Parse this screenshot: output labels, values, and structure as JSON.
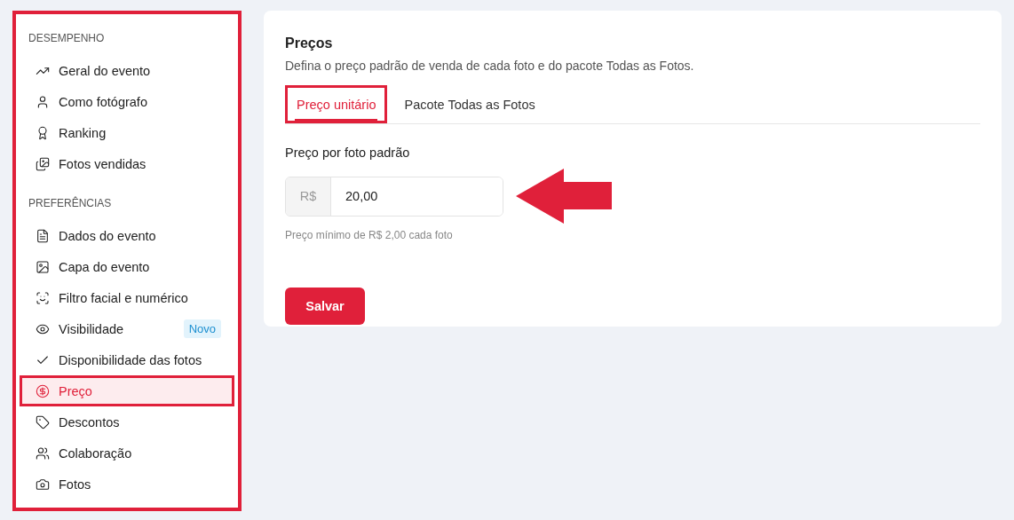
{
  "sidebar": {
    "highlighted": true,
    "sections": [
      {
        "title": "DESEMPENHO",
        "items": [
          {
            "kind": "trend",
            "label": "Geral do evento",
            "selected": false,
            "highlighted": false
          },
          {
            "kind": "user",
            "label": "Como fotógrafo",
            "selected": false,
            "highlighted": false
          },
          {
            "kind": "award",
            "label": "Ranking",
            "selected": false,
            "highlighted": false
          },
          {
            "kind": "images",
            "label": "Fotos vendidas",
            "selected": false,
            "highlighted": false
          }
        ]
      },
      {
        "title": "PREFERÊNCIAS",
        "items": [
          {
            "kind": "file",
            "label": "Dados do evento",
            "selected": false,
            "highlighted": false
          },
          {
            "kind": "image",
            "label": "Capa do evento",
            "selected": false,
            "highlighted": false
          },
          {
            "kind": "face",
            "label": "Filtro facial e numérico",
            "selected": false,
            "highlighted": false
          },
          {
            "kind": "eye",
            "label": "Visibilidade",
            "badge": "Novo",
            "selected": false,
            "highlighted": false
          },
          {
            "kind": "check",
            "label": "Disponibilidade das fotos",
            "selected": false,
            "highlighted": false
          },
          {
            "kind": "dollar",
            "label": "Preço",
            "selected": true,
            "highlighted": true
          },
          {
            "kind": "tag",
            "label": "Descontos",
            "selected": false,
            "highlighted": false
          },
          {
            "kind": "users",
            "label": "Colaboração",
            "selected": false,
            "highlighted": false
          },
          {
            "kind": "camera",
            "label": "Fotos",
            "selected": false,
            "highlighted": false
          }
        ]
      }
    ]
  },
  "card": {
    "title": "Preços",
    "description": "Defina o preço padrão de venda de cada foto e do pacote Todas as Fotos.",
    "tabs": [
      {
        "label": "Preço unitário",
        "selected": true,
        "highlighted": true
      },
      {
        "label": "Pacote Todas as Fotos",
        "selected": false,
        "highlighted": false
      }
    ],
    "price_field": {
      "label": "Preço por foto padrão",
      "prefix": "R$",
      "value": "20,00",
      "hint": "Preço mínimo de R$ 2,00 cada foto",
      "pointer_arrow": true
    },
    "save_button": "Salvar"
  }
}
